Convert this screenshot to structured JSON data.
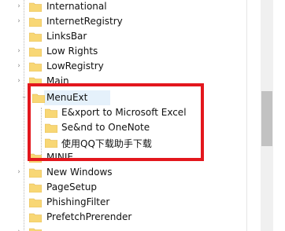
{
  "tree": {
    "items": [
      {
        "label": "International",
        "expanded": false
      },
      {
        "label": "InternetRegistry",
        "expanded": false
      },
      {
        "label": "LinksBar",
        "expanded": false
      },
      {
        "label": "Low Rights",
        "expanded": false
      },
      {
        "label": "LowRegistry",
        "expanded": false
      },
      {
        "label": "Main",
        "expanded": false
      },
      {
        "label": "MenuExt",
        "expanded": true,
        "selected": true
      },
      {
        "label": "E&xport to Microsoft Excel",
        "child": true
      },
      {
        "label": "Se&nd to OneNote",
        "child": true
      },
      {
        "label": "使用QQ下载助手下载",
        "child": true
      },
      {
        "label": "MINIE",
        "expanded": false
      },
      {
        "label": "New Windows",
        "expanded": false
      },
      {
        "label": "PageSetup",
        "expanded": false
      },
      {
        "label": "PhishingFilter",
        "expanded": false
      },
      {
        "label": "PrefetchPrerender",
        "expanded": false
      }
    ]
  },
  "icons": {
    "expand": "chevron-right-icon",
    "collapse": "chevron-down-icon",
    "folder": "folder-icon"
  },
  "colors": {
    "folder_fill": "#f8d775",
    "folder_tab": "#e8b94a",
    "highlight_box": "#e3171d",
    "selection_bg": "#e5f1fb"
  }
}
